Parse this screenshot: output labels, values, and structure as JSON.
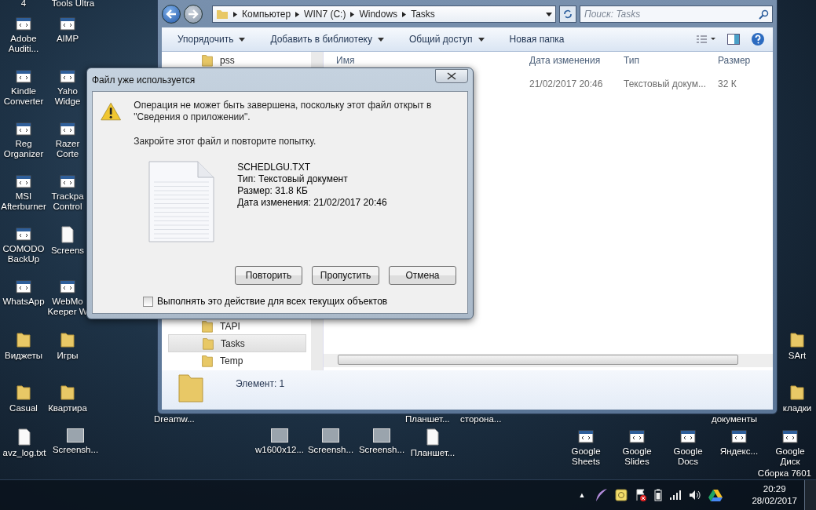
{
  "desktop": {
    "top_labels": [
      "4",
      "Tools Ultra"
    ],
    "icon_columns": [
      [
        {
          "kind": "app",
          "lines": [
            "Adobe",
            "Auditi..."
          ]
        },
        {
          "kind": "app",
          "lines": [
            "Kindle",
            "Converter"
          ]
        },
        {
          "kind": "app",
          "lines": [
            "Reg",
            "Organizer"
          ]
        },
        {
          "kind": "app",
          "lines": [
            "MSI",
            "Afterburner"
          ]
        },
        {
          "kind": "app",
          "lines": [
            "COMODO",
            "BackUp"
          ]
        },
        {
          "kind": "app",
          "lines": [
            "WhatsApp"
          ]
        },
        {
          "kind": "folder",
          "lines": [
            "Виджеты"
          ]
        },
        {
          "kind": "folder",
          "lines": [
            "Casual"
          ]
        }
      ],
      [
        {
          "kind": "app",
          "lines": [
            "AIMP"
          ]
        },
        {
          "kind": "app",
          "lines": [
            "Yaho",
            "Widge"
          ]
        },
        {
          "kind": "app",
          "lines": [
            "Razer",
            "Corte"
          ]
        },
        {
          "kind": "app",
          "lines": [
            "Trackpa",
            "Control"
          ]
        },
        {
          "kind": "file",
          "lines": [
            "Screens"
          ]
        },
        {
          "kind": "app",
          "lines": [
            "WebMo",
            "Keeper W"
          ]
        },
        {
          "kind": "folder",
          "lines": [
            "Игры"
          ]
        },
        {
          "kind": "folder",
          "lines": [
            "Квартира"
          ]
        }
      ]
    ],
    "right_icons": [
      {
        "kind": "folder",
        "lines": [
          "SArt"
        ]
      },
      {
        "kind": "folder",
        "lines": [
          "кладки"
        ]
      }
    ],
    "hidden_labels": [
      "Dreamw...",
      "Планшет...",
      "сторона...",
      "документы"
    ],
    "bottom_icons": [
      {
        "kind": "file",
        "lines": [
          "avz_log.txt"
        ]
      },
      {
        "kind": "image",
        "lines": [
          "Screensh..."
        ]
      },
      {
        "kind": "image",
        "lines": [
          "w1600x12..."
        ]
      },
      {
        "kind": "image",
        "lines": [
          "Screensh..."
        ]
      },
      {
        "kind": "image",
        "lines": [
          "Screensh..."
        ]
      },
      {
        "kind": "file",
        "lines": [
          "Планшет..."
        ]
      },
      {
        "kind": "app",
        "lines": [
          "Google",
          "Sheets"
        ]
      },
      {
        "kind": "app",
        "lines": [
          "Google",
          "Slides"
        ]
      },
      {
        "kind": "app",
        "lines": [
          "Google",
          "Docs"
        ]
      },
      {
        "kind": "app",
        "lines": [
          "Яндекс..."
        ]
      },
      {
        "kind": "app",
        "lines": [
          "Google",
          "Диск"
        ]
      }
    ],
    "build_text": "Сборка 7601"
  },
  "explorer": {
    "path": [
      "Компьютер",
      "WIN7 (C:)",
      "Windows",
      "Tasks"
    ],
    "search": {
      "placeholder": "Поиск: Tasks"
    },
    "toolbar": [
      {
        "label": "Упорядочить",
        "dropdown": true
      },
      {
        "label": "Добавить в библиотеку",
        "dropdown": true
      },
      {
        "label": "Общий доступ",
        "dropdown": true
      },
      {
        "label": "Новая папка",
        "dropdown": false
      }
    ],
    "tree": {
      "top_items": [
        {
          "label": "pss",
          "selected": false
        }
      ],
      "bottom_items": [
        {
          "label": "TAPI",
          "selected": false
        },
        {
          "label": "Tasks",
          "selected": true
        },
        {
          "label": "Temp",
          "selected": false
        }
      ]
    },
    "columns": [
      "Имя",
      "Дата изменения",
      "Тип",
      "Размер"
    ],
    "rows": [
      {
        "date": "21/02/2017 20:46",
        "type": "Текстовый докум...",
        "size": "32 К"
      }
    ],
    "status": "Элемент: 1"
  },
  "dialog": {
    "title": "Файл уже используется",
    "message": "Операция не может быть завершена, поскольку этот файл открыт в \"Сведения о приложении\".",
    "hint": "Закройте этот файл и повторите попытку.",
    "file_info": [
      "SCHEDLGU.TXT",
      "Тип: Текстовый документ",
      "Размер: 31.8 КБ",
      "Дата изменения: 21/02/2017 20:46"
    ],
    "buttons": [
      "Повторить",
      "Пропустить",
      "Отмена"
    ],
    "apply_all": {
      "label": "Выполнять это действие для всех текущих объектов",
      "checked": false
    }
  },
  "taskbar": {
    "show_hidden": "▲",
    "time": "20:29",
    "date": "28/02/2017"
  }
}
